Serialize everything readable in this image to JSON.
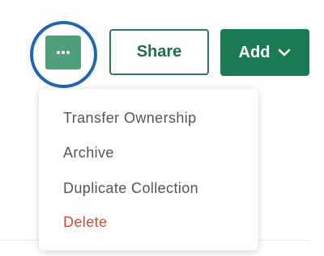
{
  "toolbar": {
    "more_button": {
      "icon": "more-horizontal-icon",
      "color": "#4f9e7c",
      "highlight_color": "#1f65b7"
    },
    "share_label": "Share",
    "add_label": "Add",
    "add_icon": "chevron-down-icon",
    "brand_color": "#1a7a52"
  },
  "menu": {
    "items": [
      {
        "label": "Transfer Ownership"
      },
      {
        "label": "Archive"
      },
      {
        "label": "Duplicate Collection"
      },
      {
        "label": "Delete",
        "color": "#cf4a3a"
      }
    ]
  }
}
